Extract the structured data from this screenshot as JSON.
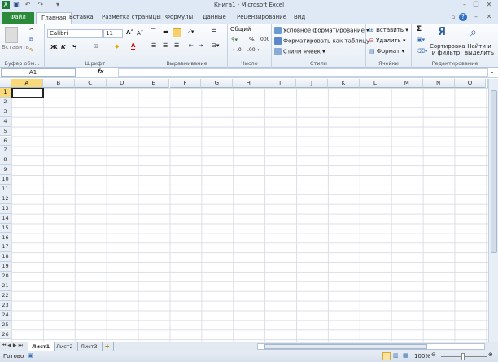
{
  "window": {
    "title": "Книга1 - Microsoft Excel"
  },
  "tabs": [
    "Файл",
    "Главная",
    "Вставка",
    "Разметка страницы",
    "Формулы",
    "Данные",
    "Рецензирование",
    "Вид"
  ],
  "ribbon": {
    "clipboard": {
      "paste": "Вставить",
      "label": "Буфер обм..."
    },
    "font": {
      "name": "Calibri",
      "size": "11",
      "bold": "Ж",
      "italic": "К",
      "underline": "Ч",
      "label": "Шрифт"
    },
    "alignment": {
      "label": "Выравнивание"
    },
    "number": {
      "format": "Общий",
      "percent": "%",
      "thousands": "000",
      "label": "Число"
    },
    "styles": {
      "conditional": "Условное форматирование",
      "as_table": "Форматировать как таблицу",
      "cell_styles": "Стили ячеек",
      "label": "Стили"
    },
    "cells": {
      "insert": "Вставить",
      "delete": "Удалить",
      "format": "Формат",
      "label": "Ячейки"
    },
    "editing": {
      "sort": "Сортировка и фильтр",
      "find": "Найти и выделить",
      "sum": "Σ",
      "label": "Редактирование"
    }
  },
  "formula_bar": {
    "name_box": "A1",
    "fx": "fx",
    "value": ""
  },
  "columns": [
    "A",
    "B",
    "C",
    "D",
    "E",
    "F",
    "G",
    "H",
    "I",
    "J",
    "K",
    "L",
    "M",
    "N",
    "O"
  ],
  "rows": [
    "1",
    "2",
    "3",
    "4",
    "5",
    "6",
    "7",
    "8",
    "9",
    "10",
    "11",
    "12",
    "13",
    "14",
    "15",
    "16",
    "17",
    "18",
    "19",
    "20",
    "21",
    "22",
    "23",
    "24",
    "25",
    "26"
  ],
  "sheets": [
    "Лист1",
    "Лист2",
    "Лист3"
  ],
  "status": {
    "ready": "Готово",
    "zoom": "100%"
  },
  "colors": {
    "file_tab": "#2a8a3a",
    "selection": "#f9d97a"
  }
}
